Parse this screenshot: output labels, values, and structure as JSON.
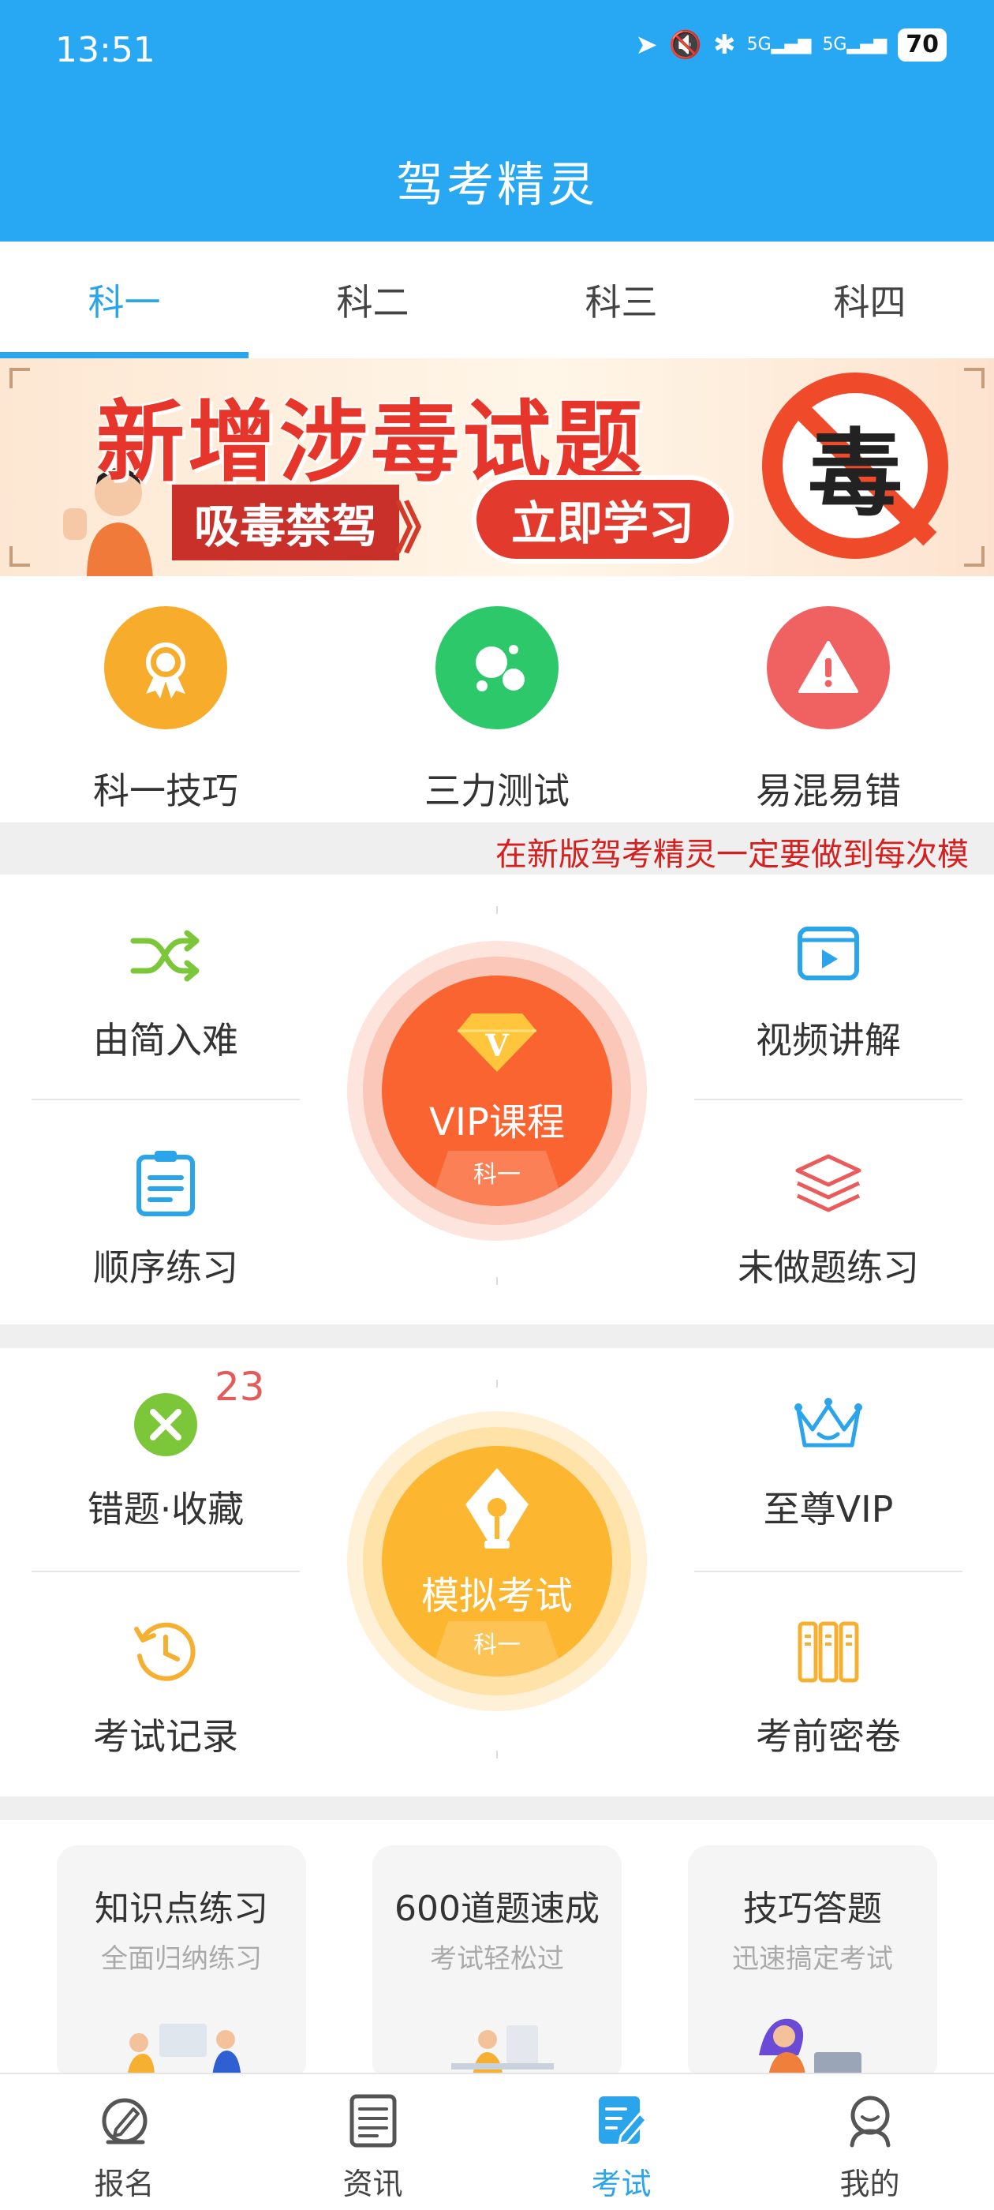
{
  "status_bar": {
    "time": "13:51",
    "battery": "70",
    "signal_1": "5G",
    "signal_2": "5G"
  },
  "header": {
    "title": "驾考精灵"
  },
  "tabs": [
    {
      "label": "科一",
      "active": true
    },
    {
      "label": "科二",
      "active": false
    },
    {
      "label": "科三",
      "active": false
    },
    {
      "label": "科四",
      "active": false
    }
  ],
  "banner": {
    "title": "新增涉毒试题",
    "subtitle": "吸毒禁驾",
    "arrows": "》",
    "button": "立即学习",
    "sign_char": "毒"
  },
  "quick_actions": [
    {
      "label": "科一技巧",
      "icon": "ribbon-medal-icon",
      "color": "#f8ac2b"
    },
    {
      "label": "三力测试",
      "icon": "bubbles-icon",
      "color": "#2dc86a"
    },
    {
      "label": "易混易错",
      "icon": "warning-icon",
      "color": "#f06262"
    }
  ],
  "marquee": {
    "text": "在新版驾考精灵一定要做到每次模"
  },
  "practice_section": {
    "left": [
      {
        "label": "由简入难",
        "icon": "shuffle-icon"
      },
      {
        "label": "顺序练习",
        "icon": "clipboard-icon"
      }
    ],
    "right": [
      {
        "label": "视频讲解",
        "icon": "video-play-icon"
      },
      {
        "label": "未做题练习",
        "icon": "layers-icon"
      }
    ],
    "center": {
      "label": "VIP课程",
      "sub": "科一",
      "badge_letter": "V"
    }
  },
  "exam_section": {
    "left": [
      {
        "label": "错题·收藏",
        "icon": "wrong-x-icon",
        "badge": "23"
      },
      {
        "label": "考试记录",
        "icon": "history-clock-icon"
      }
    ],
    "right": [
      {
        "label": "至尊VIP",
        "icon": "crown-icon"
      },
      {
        "label": "考前密卷",
        "icon": "binders-icon"
      }
    ],
    "center": {
      "label": "模拟考试",
      "sub": "科一"
    }
  },
  "cards": [
    {
      "title": "知识点练习",
      "subtitle": "全面归纳练习"
    },
    {
      "title": "600道题速成",
      "subtitle": "考试轻松过"
    },
    {
      "title": "技巧答题",
      "subtitle": "迅速搞定考试"
    }
  ],
  "bottom_nav": [
    {
      "label": "报名",
      "icon": "signup-pen-icon",
      "active": false
    },
    {
      "label": "资讯",
      "icon": "news-icon",
      "active": false
    },
    {
      "label": "考试",
      "icon": "exam-edit-icon",
      "active": true
    },
    {
      "label": "我的",
      "icon": "profile-icon",
      "active": false
    }
  ],
  "colors": {
    "primary": "#28a8f2",
    "active_tab": "#2aa4ea",
    "vip_orange": "#fa6430",
    "exam_yellow": "#fdb62f",
    "marquee_red": "#d61f1f"
  }
}
